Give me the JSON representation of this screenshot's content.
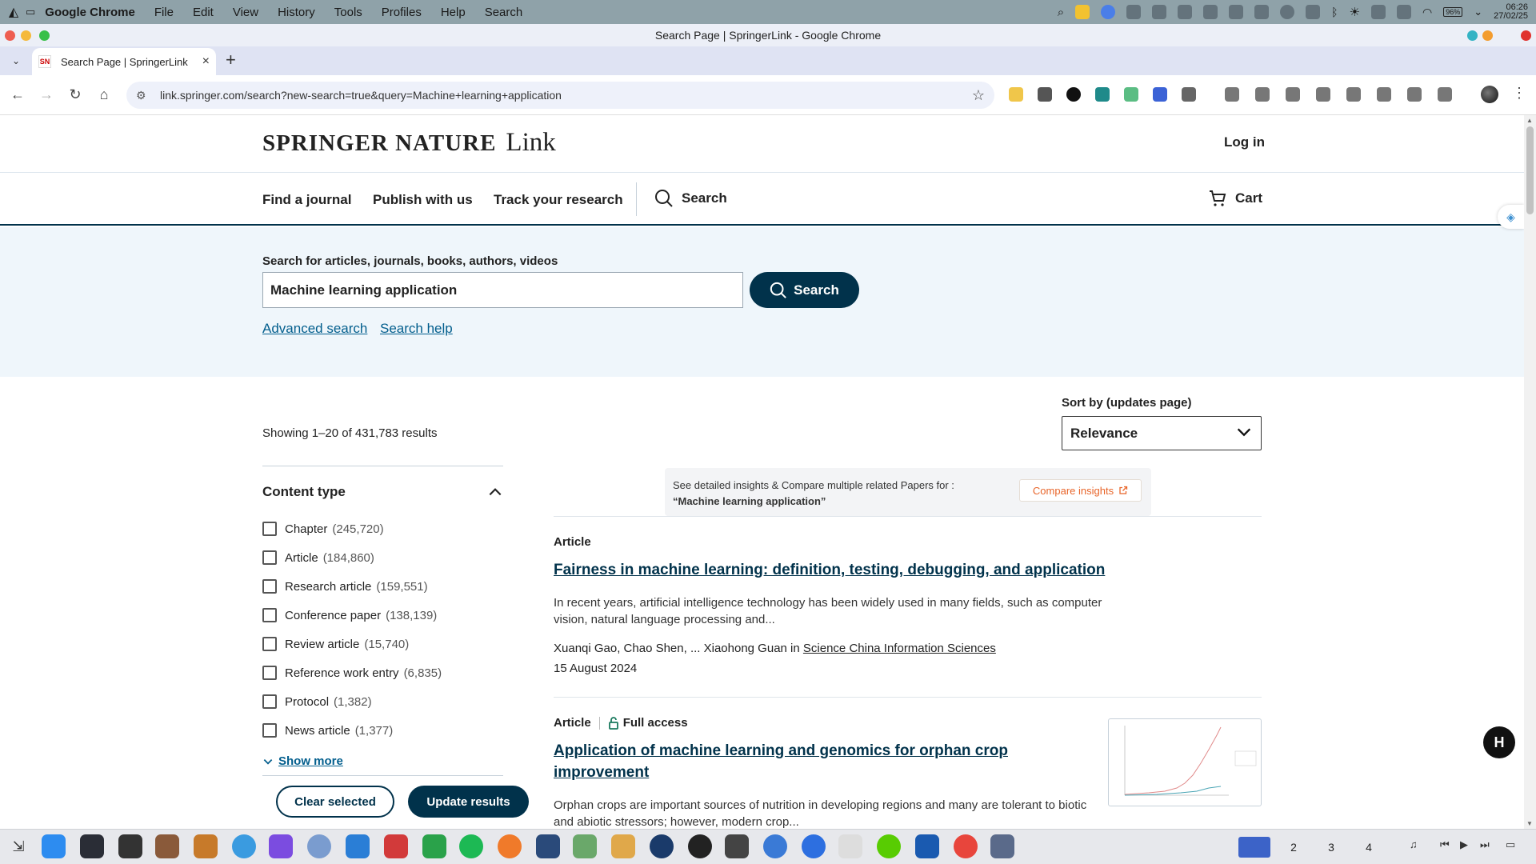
{
  "menubar": {
    "app_name": "Google Chrome",
    "menus": [
      "File",
      "Edit",
      "View",
      "History",
      "Tools",
      "Profiles",
      "Help",
      "Search"
    ],
    "clock_time": "06:26",
    "clock_date": "27/02/25",
    "battery": "96%"
  },
  "window": {
    "title": "Search Page | SpringerLink - Google Chrome"
  },
  "tabs": [
    {
      "favicon": "SN",
      "title": "Search Page | SpringerLink"
    }
  ],
  "omnibox": {
    "url": "link.springer.com/search?new-search=true&query=Machine+learning+application"
  },
  "site": {
    "brand": "SPRINGER NATURE",
    "brand_suffix": "Link",
    "login": "Log in",
    "nav": {
      "find_journal": "Find a journal",
      "publish": "Publish with us",
      "track": "Track your research",
      "search": "Search",
      "cart": "Cart"
    }
  },
  "search": {
    "label": "Search for articles, journals, books, authors, videos",
    "query": "Machine learning application",
    "button": "Search",
    "advanced": "Advanced search",
    "help": "Search help"
  },
  "results_summary": "Showing 1–20 of 431,783 results",
  "sort": {
    "label": "Sort by (updates page)",
    "value": "Relevance"
  },
  "filter": {
    "heading": "Content type",
    "items": [
      {
        "label": "Chapter",
        "count": "(245,720)"
      },
      {
        "label": "Article",
        "count": "(184,860)"
      },
      {
        "label": "Research article",
        "count": "(159,551)"
      },
      {
        "label": "Conference paper",
        "count": "(138,139)"
      },
      {
        "label": "Review article",
        "count": "(15,740)"
      },
      {
        "label": "Reference work entry",
        "count": "(6,835)"
      },
      {
        "label": "Protocol",
        "count": "(1,382)"
      },
      {
        "label": "News article",
        "count": "(1,377)"
      }
    ],
    "show_more": "Show more",
    "clear": "Clear selected",
    "update": "Update results"
  },
  "insight": {
    "text": "See detailed insights & Compare multiple related Papers for :",
    "query": "“Machine learning application”",
    "button": "Compare insights"
  },
  "results": [
    {
      "type": "Article",
      "title": "Fairness in machine learning: definition, testing, debugging, and application",
      "snippet_line1": "In recent years, artificial intelligence technology has been widely used in many fields, such as computer",
      "snippet_line2": "vision, natural language processing and...",
      "authors": "Xuanqi Gao, Chao Shen, ... Xiaohong Guan in",
      "journal": "Science China Information Sciences",
      "date": "15 August 2024"
    },
    {
      "type": "Article",
      "access": "Full access",
      "title_line1": "Application of machine learning and genomics for orphan crop",
      "title_line2": "improvement",
      "snippet_line1": "Orphan crops are important sources of nutrition in developing regions and many are tolerant to biotic",
      "snippet_line2": "and abiotic stressors; however, modern crop..."
    }
  ],
  "dock": {
    "workspaces": [
      "2",
      "3",
      "4"
    ]
  },
  "colors": {
    "brand_navy": "#01324b",
    "link_blue": "#025e8d",
    "search_band": "#eff6fb",
    "orange": "#e8652a"
  }
}
